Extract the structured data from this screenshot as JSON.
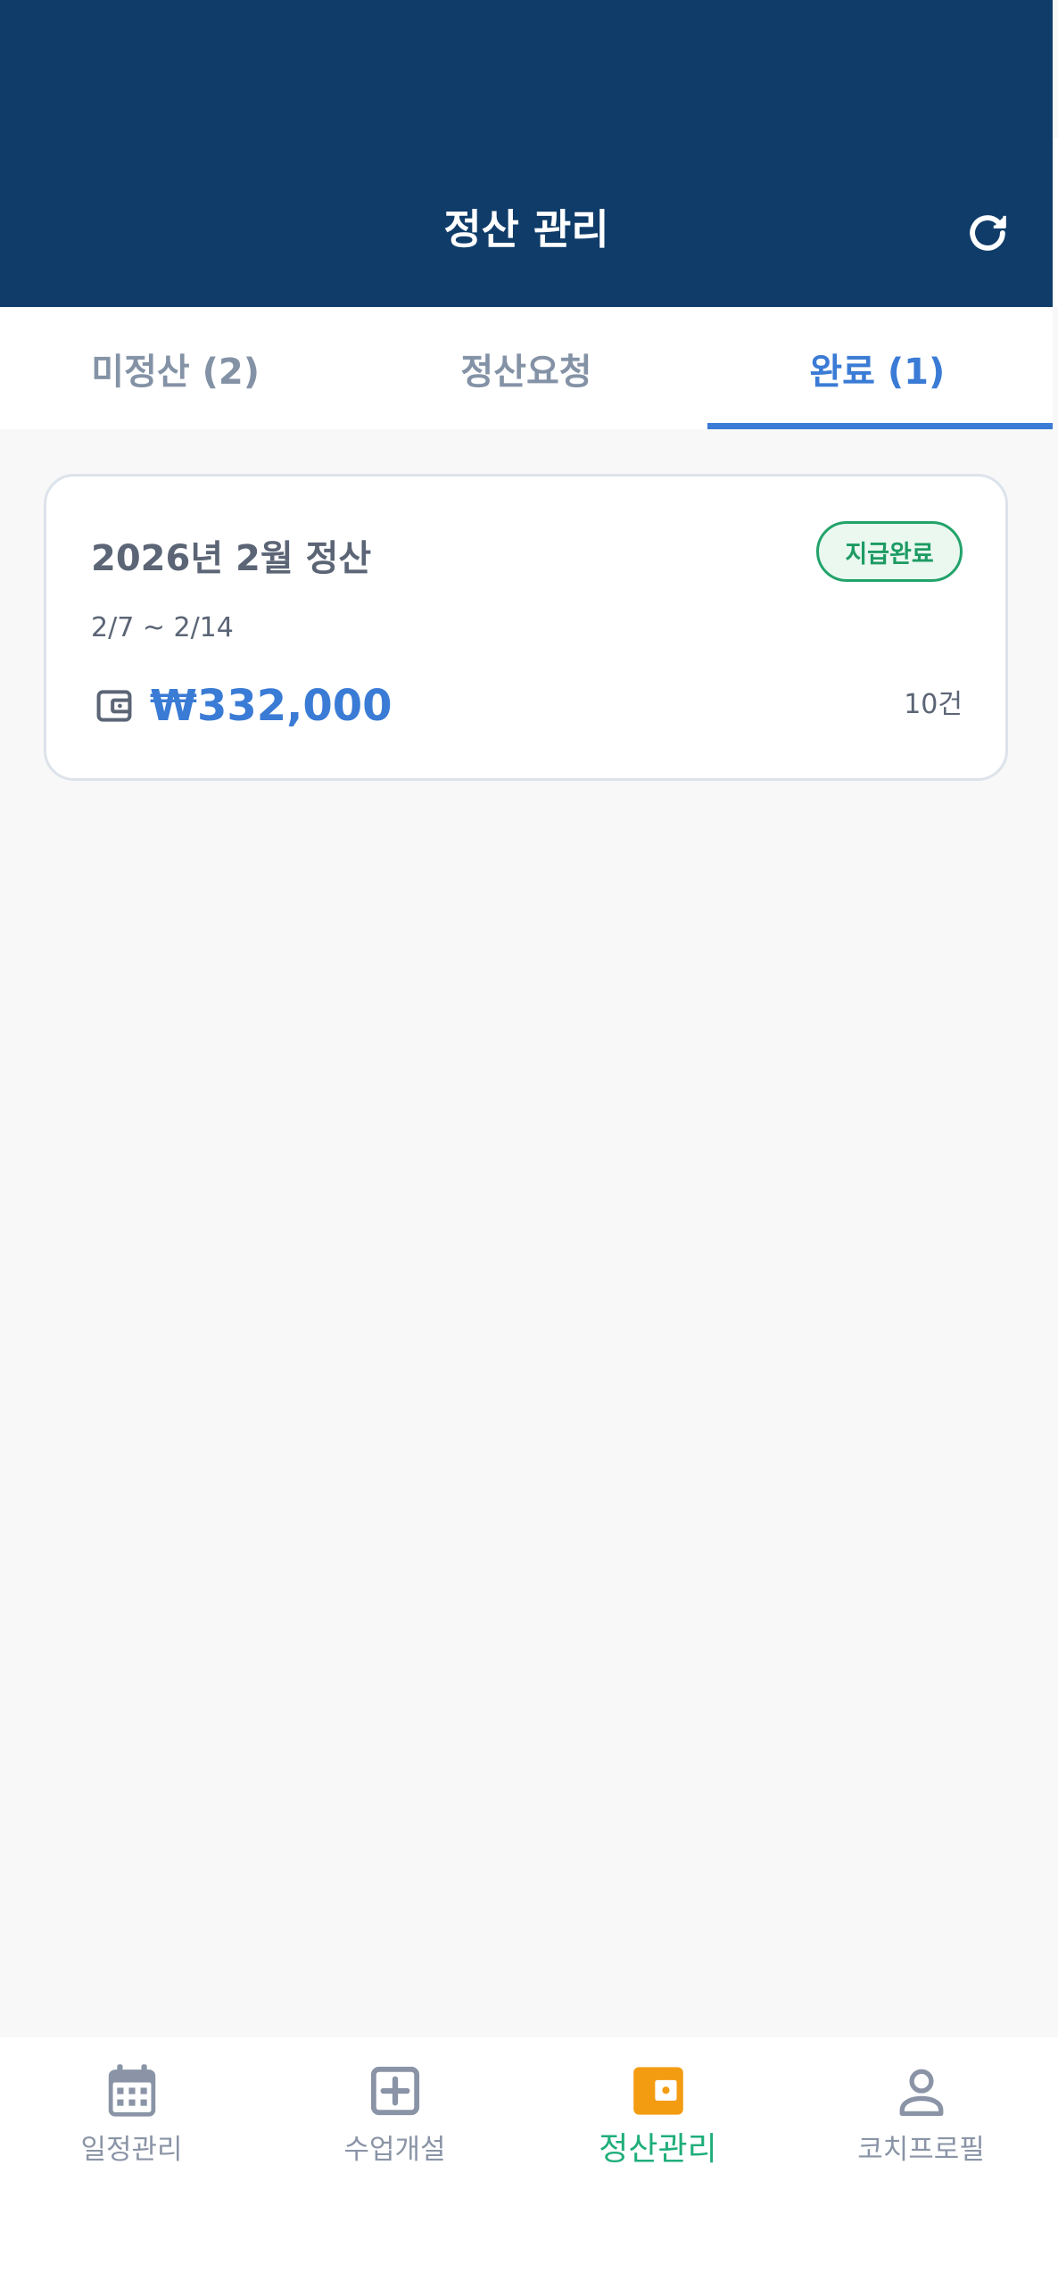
{
  "header": {
    "title": "정산 관리",
    "refresh_icon": "refresh-icon"
  },
  "tabs": [
    {
      "label": "미정산 (2)",
      "active": false
    },
    {
      "label": "정산요청",
      "active": false
    },
    {
      "label": "완료 (1)",
      "active": true
    }
  ],
  "settlements": [
    {
      "title": "2026년 2월 정산",
      "status": "지급완료",
      "period": "2/7 ~ 2/14",
      "amount": "₩332,000",
      "count": "10건",
      "icon": "wallet-icon"
    }
  ],
  "bottom_nav": [
    {
      "label": "일정관리",
      "icon": "calendar-icon",
      "active": false
    },
    {
      "label": "수업개설",
      "icon": "plus-square-icon",
      "active": false
    },
    {
      "label": "정산관리",
      "icon": "wallet-icon",
      "active": true
    },
    {
      "label": "코치프로필",
      "icon": "person-icon",
      "active": false
    }
  ],
  "colors": {
    "header_bg": "#0f3c69",
    "accent_blue": "#3a7bd5",
    "accent_green": "#1fae7a",
    "accent_orange": "#f39c12",
    "muted_text": "#8a94a6"
  }
}
